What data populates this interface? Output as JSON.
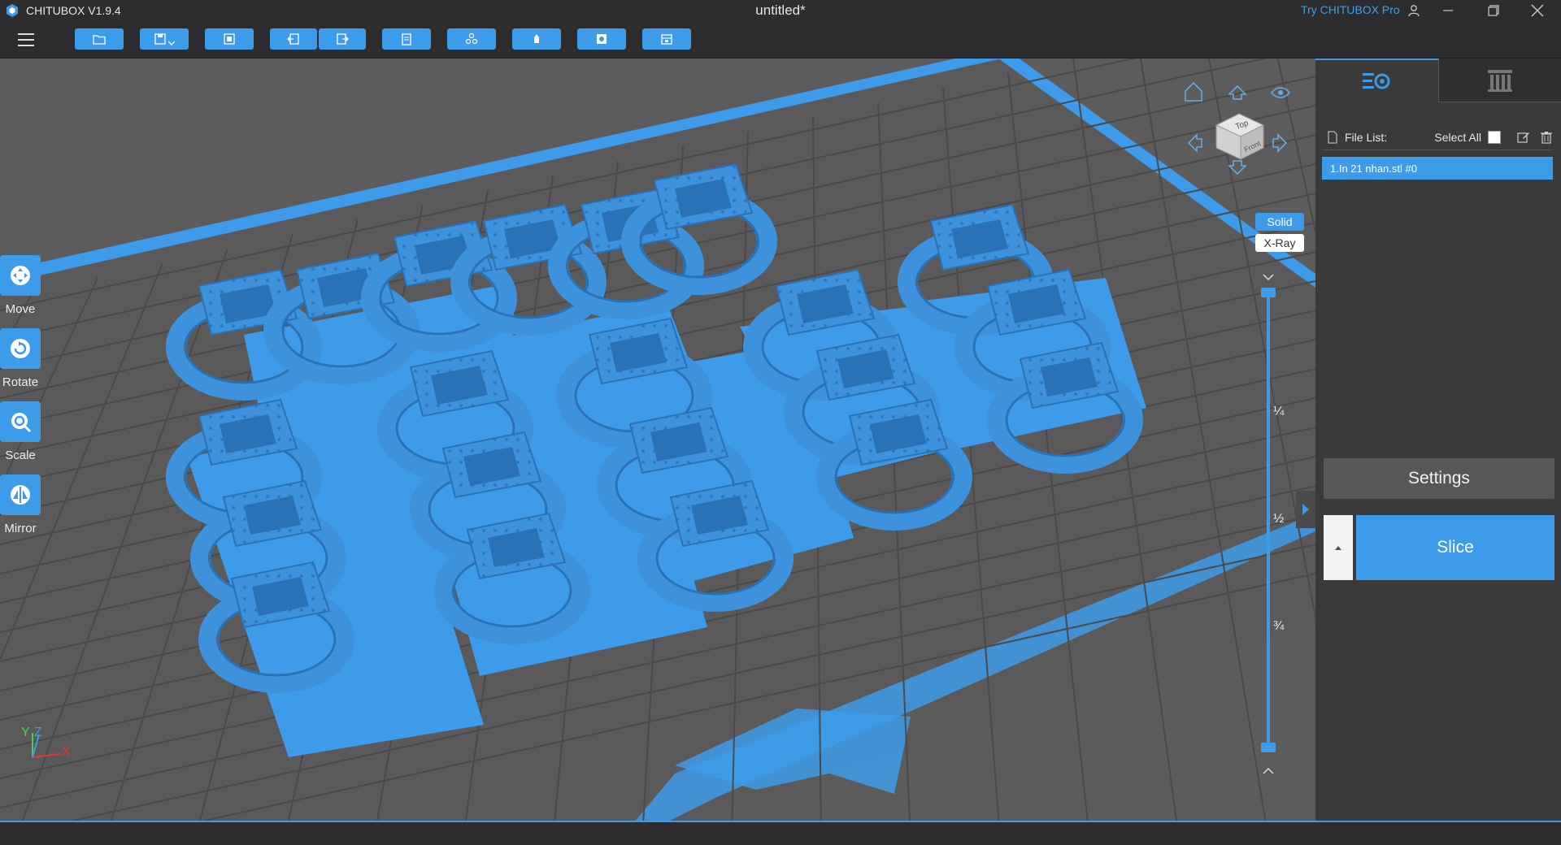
{
  "window": {
    "app_name": "CHITUBOX V1.9.4",
    "doc_title": "untitled*",
    "try_pro": "Try CHITUBOX Pro"
  },
  "toolbar": {
    "items": [
      "open-file-icon",
      "save-icon",
      "auto-layout-icon",
      "undo-icon",
      "redo-icon",
      "clipboard-icon",
      "arrange-icon",
      "supports-icon",
      "hollow-icon",
      "print-settings-icon"
    ]
  },
  "left_tools": [
    {
      "label": "Move",
      "icon": "move-icon"
    },
    {
      "label": "Rotate",
      "icon": "rotate-icon"
    },
    {
      "label": "Scale",
      "icon": "scale-icon"
    },
    {
      "label": "Mirror",
      "icon": "mirror-icon"
    }
  ],
  "view": {
    "solid": "Solid",
    "xray": "X-Ray",
    "cube_top": "Top",
    "cube_front": "Front"
  },
  "layer_slider": {
    "marks": [
      "¼",
      "½",
      "¾"
    ]
  },
  "axes": {
    "x": "X",
    "y": "Y",
    "z": "Z"
  },
  "panel": {
    "file_list_label": "File List:",
    "select_all": "Select All",
    "file_item": "1.In 21 nhan.stl #0",
    "settings": "Settings",
    "slice": "Slice"
  },
  "colors": {
    "accent": "#3d9be9",
    "model": "#3e92dc",
    "plate": "#5c5c5c"
  }
}
